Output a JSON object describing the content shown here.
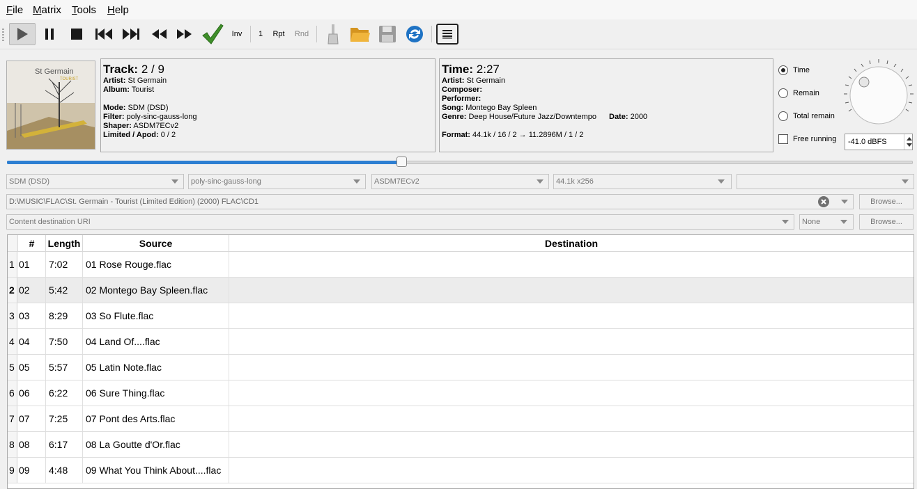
{
  "menu": [
    "File",
    "Matrix",
    "Tools",
    "Help"
  ],
  "toolbar": {
    "inv_label": "Inv",
    "repeat_count": "1",
    "rpt_label": "Rpt",
    "rnd_label": "Rnd"
  },
  "track_panel": {
    "track_label": "Track:",
    "track_value": "2 / 9",
    "artist_label": "Artist:",
    "artist_value": "St Germain",
    "album_label": "Album:",
    "album_value": "Tourist",
    "mode_label": "Mode:",
    "mode_value": "SDM (DSD)",
    "filter_label": "Filter:",
    "filter_value": "poly-sinc-gauss-long",
    "shaper_label": "Shaper:",
    "shaper_value": "ASDM7ECv2",
    "limited_label": "Limited / Apod:",
    "limited_value": "0 / 2"
  },
  "album_art": {
    "artist": "St Germain",
    "album": "TOURIST"
  },
  "time_panel": {
    "time_label": "Time:",
    "time_value": "2:27",
    "artist_label": "Artist:",
    "artist_value": "St Germain",
    "composer_label": "Composer:",
    "performer_label": "Performer:",
    "song_label": "Song:",
    "song_value": "Montego Bay Spleen",
    "genre_label": "Genre:",
    "genre_value": "Deep House/Future Jazz/Downtempo",
    "date_label": "Date:",
    "date_value": "2000",
    "format_label": "Format:",
    "format_value": "44.1k / 16 / 2 → 11.2896M / 1 / 2"
  },
  "display_options": {
    "time": "Time",
    "remain": "Remain",
    "total_remain": "Total remain",
    "free_running": "Free running",
    "selected": "time"
  },
  "volume": {
    "value": "-41.0 dBFS"
  },
  "progress": {
    "fraction": 0.435
  },
  "settings": {
    "mode": "SDM (DSD)",
    "filter": "poly-sinc-gauss-long",
    "shaper": "ASDM7ECv2",
    "rate": "44.1k x256",
    "extra": ""
  },
  "source_path": "D:\\MUSIC\\FLAC\\St. Germain - Tourist (Limited Edition) (2000) FLAC\\CD1",
  "dest_placeholder": "Content destination URI",
  "dest_option": "None",
  "browse_label": "Browse...",
  "table": {
    "headers": [
      "#",
      "Length",
      "Source",
      "Destination"
    ],
    "rows": [
      {
        "idx": "1",
        "num": "01",
        "length": "7:02",
        "source": "01 Rose Rouge.flac",
        "dest": ""
      },
      {
        "idx": "2",
        "num": "02",
        "length": "5:42",
        "source": "02 Montego Bay Spleen.flac",
        "dest": ""
      },
      {
        "idx": "3",
        "num": "03",
        "length": "8:29",
        "source": "03 So Flute.flac",
        "dest": ""
      },
      {
        "idx": "4",
        "num": "04",
        "length": "7:50",
        "source": "04 Land Of....flac",
        "dest": ""
      },
      {
        "idx": "5",
        "num": "05",
        "length": "5:57",
        "source": "05 Latin Note.flac",
        "dest": ""
      },
      {
        "idx": "6",
        "num": "06",
        "length": "6:22",
        "source": "06 Sure Thing.flac",
        "dest": ""
      },
      {
        "idx": "7",
        "num": "07",
        "length": "7:25",
        "source": "07 Pont des Arts.flac",
        "dest": ""
      },
      {
        "idx": "8",
        "num": "08",
        "length": "6:17",
        "source": "08 La Goutte d'Or.flac",
        "dest": ""
      },
      {
        "idx": "9",
        "num": "09",
        "length": "4:48",
        "source": "09 What You Think About....flac",
        "dest": ""
      }
    ]
  },
  "colors": {
    "accent": "#2d7fd2",
    "checkmark": "#3f8f2a"
  }
}
